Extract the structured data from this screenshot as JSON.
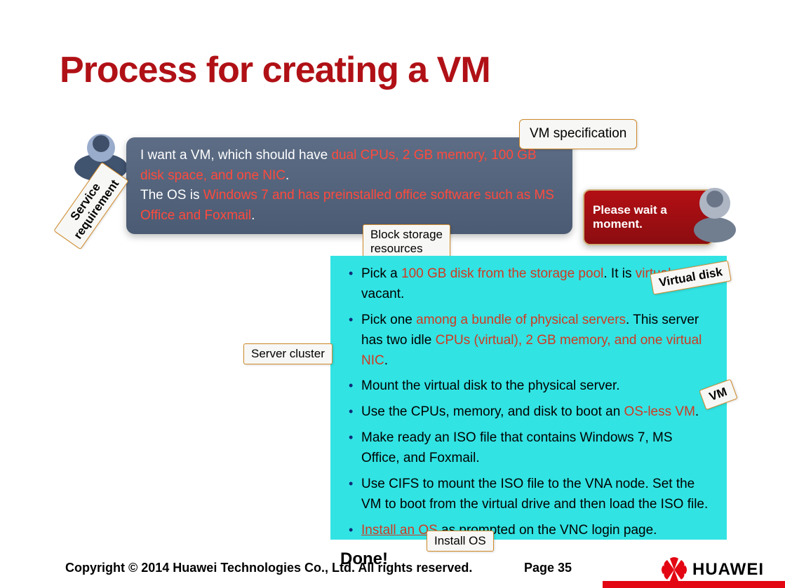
{
  "title": "Process for creating a VM",
  "requirement": {
    "line1_pre": "I want a VM, which should have ",
    "line1_hl": "dual CPUs, 2 GB memory, 100 GB disk space, and one NIC",
    "line1_post": ".",
    "line2_pre": "The OS is ",
    "line2_hl": "Windows 7 and has preinstalled office software such as MS Office and Foxmail",
    "line2_post": "."
  },
  "callouts": {
    "vmspec": "VM specification",
    "service": "Service requirement",
    "block": "Block storage resources",
    "server": "Server cluster",
    "virtdisk": "Virtual disk",
    "vm": "VM",
    "install": "Install OS"
  },
  "wait": "Please wait a moment.",
  "steps": [
    {
      "pre": "Pick a ",
      "hl": "100 GB disk from the storage pool",
      "post": ". It is ",
      "hl2": "virtual",
      "post2": " and vacant."
    },
    {
      "pre": "Pick one ",
      "hl": "among a bundle of physical servers",
      "post": ". This server has two idle ",
      "hl2": "CPUs (virtual), 2 GB memory, and one virtual NIC",
      "post2": "."
    },
    {
      "pre": "Mount the virtual disk to the physical server.",
      "hl": "",
      "post": "",
      "hl2": "",
      "post2": ""
    },
    {
      "pre": "Use the CPUs, memory, and disk to boot an ",
      "hl": "OS-less VM",
      "post": ".",
      "hl2": "",
      "post2": ""
    },
    {
      "pre": "Make ready an ISO file that contains Windows 7, MS Office, and Foxmail.",
      "hl": "",
      "post": "",
      "hl2": "",
      "post2": ""
    },
    {
      "pre": "Use CIFS to mount the ISO file to the VNA node. Set the VM to boot from the virtual drive and then load the ISO file.",
      "hl": "",
      "post": "",
      "hl2": "",
      "post2": ""
    },
    {
      "pre": "",
      "hl": "Install an OS",
      "underline": true,
      "post": " as prompted on the VNC login page.",
      "hl2": "",
      "post2": ""
    }
  ],
  "done": "Done!",
  "footer": {
    "copyright": "Copyright © 2014 Huawei Technologies Co., Ltd. All rights reserved.",
    "page": "Page 35",
    "brand": "HUAWEI"
  }
}
